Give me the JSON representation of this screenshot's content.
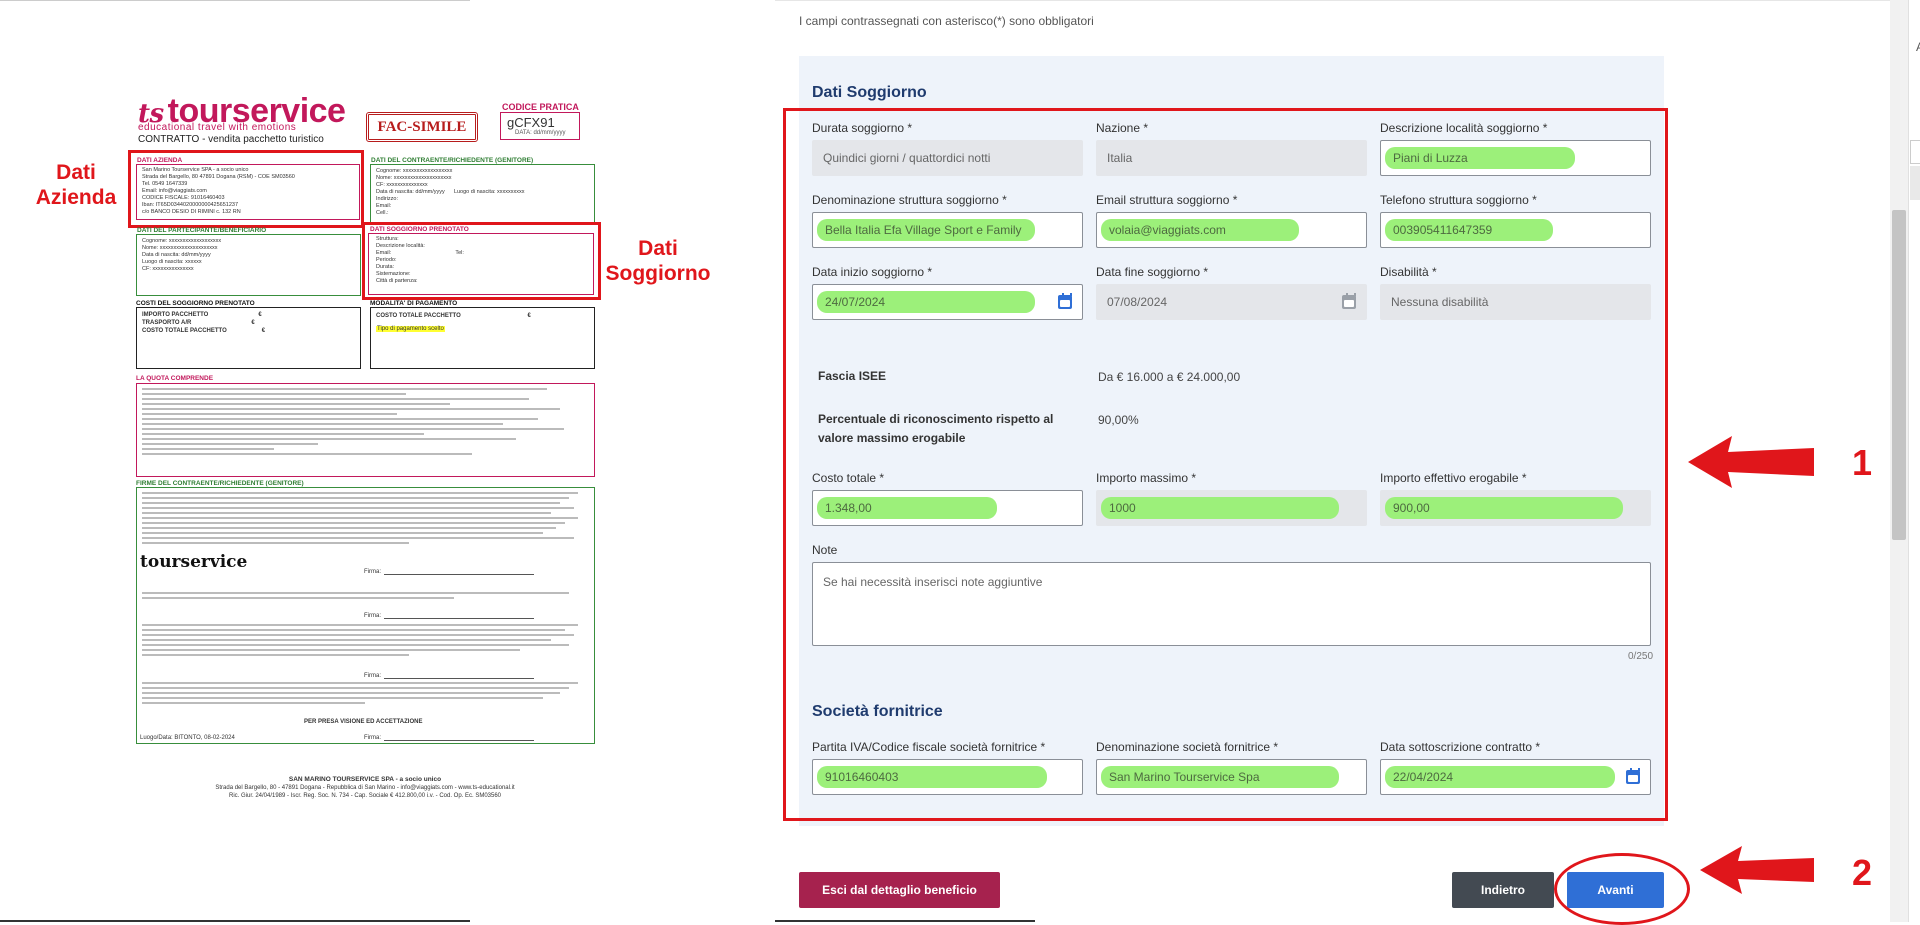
{
  "doc": {
    "logo": "tourservice",
    "logo_tagline": "educational travel with emotions",
    "subtitle": "CONTRATTO - vendita pacchetto turistico",
    "stamp": "FAC-SIMILE",
    "pratica_label": "CODICE PRATICA",
    "pratica_code": "gCFX91",
    "pratica_date": "DATA: dd/mm/yyyy",
    "box_azienda_title": "DATI AZIENDA",
    "box_azienda_lines": "San Marino Tourservice SPA - a socio unico\nStrada del Bargello, 80 47891 Dogana (RSM) - COE SM03560\nTel. 0549 1647339\nEmail: info@viaggiats.com\nCODICE FISCALE: 91016460403\nIban: IT65D0344020000000425651237\nc/o BANCO DESIO DI RIMINI c. 132 RN",
    "box_contraente_title": "DATI DEL CONTRAENTE/RICHIEDENTE (Genitore)",
    "box_contraente_lines": "Cognome: xxxxxxxxxxxxxxxxxx\nNome: xxxxxxxxxxxxxxxxxxxxx\nCF: xxxxxxxxxxxxxxx\nData di nascita: dd/mm/yyyy      Luogo di nascita: xxxxxxxxxx\nIndirizzo:\nEmail:\nCell.:",
    "box_partecipante_title": "DATI DEL PARTECIPANTE/BENEFICIARIO",
    "box_partecipante_lines": "Cognome: xxxxxxxxxxxxxxxxxxx\nNome: xxxxxxxxxxxxxxxxxxxxx\nData di nascita: dd/mm/yyyy\nLuogo di nascita: xxxxxx\nCF: xxxxxxxxxxxxxxx",
    "box_soggiorno_title": "DATI SOGGIORNO PRENOTATO",
    "box_soggiorno_lines": "Struttura:\nDescrizione località:\nEmail:                                          Tel:\nPeriodo:\nDurata:\nSistemazione:\nCittà di partenza:",
    "box_costi_title": "COSTI DEL SOGGIORNO PRENOTATO",
    "box_costi_lines": "IMPORTO PACCHETTO                              €\nTRASPORTO A/R                                    €\nCOSTO TOTALE PACCHETTO                     €",
    "box_pagamento_title": "MODALITA' DI PAGAMENTO",
    "box_pagamento_lines": "COSTO TOTALE PACCHETTO                                        €",
    "box_pagamento_highlight": "Tipo di pagamento scelto",
    "box_quota_title": "LA QUOTA COMPRENDE",
    "box_firme_title": "FIRME DEL CONTRAENTE/RICHIEDENTE (Genitore)",
    "firma_label": "Firma:",
    "firme_place_date": "Luogo/Data: BITONTO, 08-02-2024",
    "per_presa_visione": "PER PRESA VISIONE ED ACCETTAZIONE",
    "footer_title": "SAN MARINO TOURSERVICE SPA - a socio unico",
    "footer_line1": "Strada del Bargello, 80 - 47891 Dogana - Repubblica di San Marino - info@viaggiats.com - www.ts-educational.it",
    "footer_line2": "Ric. Giur. 24/04/1989 - Iscr. Reg. Soc. N. 734 - Cap. Sociale € 412.800,00 i.v. - Cod. Op. Ec. SM03560",
    "label_azienda": "Dati\nAzienda",
    "label_soggiorno": "Dati\nSoggiorno"
  },
  "form": {
    "required_hint": "I campi contrassegnati con asterisco(*) sono obbligatori",
    "section_soggiorno": "Dati Soggiorno",
    "durata_label": "Durata soggiorno *",
    "durata_value": "Quindici giorni / quattordici notti",
    "nazione_label": "Nazione *",
    "nazione_value": "Italia",
    "descrizione_label": "Descrizione località soggiorno *",
    "descrizione_value": "Piani di Luzza",
    "denominazione_label": "Denominazione struttura soggiorno *",
    "denominazione_value": "Bella Italia Efa Village Sport e Family",
    "email_label": "Email struttura soggiorno *",
    "email_value": "volaia@viaggiats.com",
    "telefono_label": "Telefono struttura soggiorno *",
    "telefono_value": "003905411647359",
    "data_inizio_label": "Data inizio soggiorno *",
    "data_inizio_value": "24/07/2024",
    "data_fine_label": "Data fine soggiorno *",
    "data_fine_value": "07/08/2024",
    "disabilita_label": "Disabilità *",
    "disabilita_value": "Nessuna disabilità",
    "isee_label": "Fascia ISEE",
    "isee_value": "Da € 16.000 a € 24.000,00",
    "percentuale_label": "Percentuale di riconoscimento rispetto al valore massimo erogabile",
    "percentuale_value": "90,00%",
    "costo_label": "Costo totale *",
    "costo_value": "1.348,00",
    "importo_max_label": "Importo massimo *",
    "importo_max_value": "1000",
    "importo_eff_label": "Importo effettivo erogabile *",
    "importo_eff_value": "900,00",
    "note_label": "Note",
    "note_placeholder": "Se hai necessità inserisci note aggiuntive",
    "note_counter": "0/250",
    "section_societa": "Società fornitrice",
    "piva_label": "Partita IVA/Codice fiscale società fornitrice *",
    "piva_value": "91016460403",
    "den_societa_label": "Denominazione società fornitrice *",
    "den_societa_value": "San Marino Tourservice Spa",
    "data_sott_label": "Data sottoscrizione contratto *",
    "data_sott_value": "22/04/2024",
    "btn_exit": "Esci dal dettaglio beneficio",
    "btn_back": "Indietro",
    "btn_next": "Avanti"
  },
  "annotations": {
    "num_1": "1",
    "num_2": "2",
    "edge_letter": "A"
  },
  "colors": {
    "annotation_red": "#e0161b",
    "highlight_green": "#9cf07a",
    "brand_magenta": "#c2185b",
    "section_blue": "#1f3b6e",
    "btn_primary": "#2f6fd6",
    "btn_exit": "#a6224e",
    "btn_back": "#434a52"
  }
}
